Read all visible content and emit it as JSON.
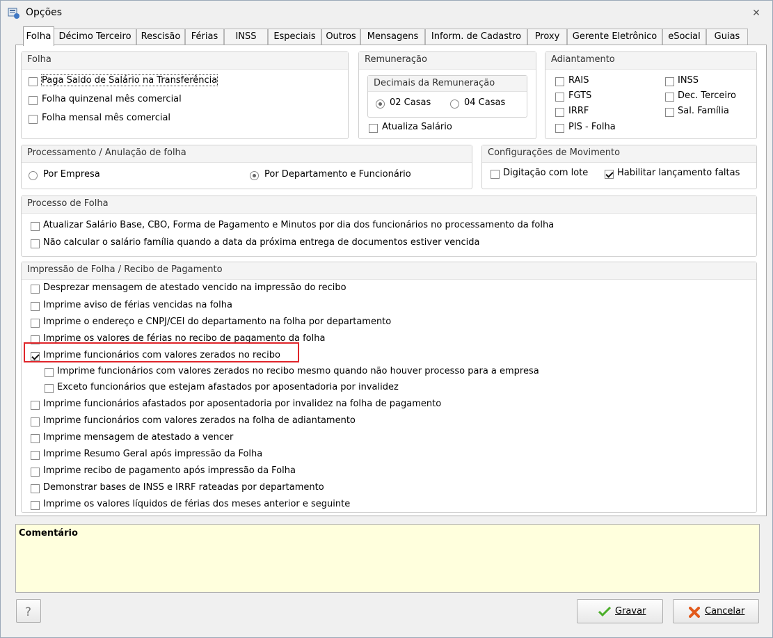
{
  "window": {
    "title": "Opções"
  },
  "tabs": [
    "Folha",
    "Décimo Terceiro",
    "Rescisão",
    "Férias",
    "INSS",
    "Especiais",
    "Outros",
    "Mensagens",
    "Inform. de Cadastro",
    "Proxy",
    "Gerente Eletrônico",
    "eSocial",
    "Guias"
  ],
  "folha_group": {
    "title": "Folha",
    "items": [
      {
        "label": "Paga Saldo de Salário na Transferência",
        "checked": false
      },
      {
        "label": "Folha quinzenal mês comercial",
        "checked": false
      },
      {
        "label": "Folha mensal mês comercial",
        "checked": false
      }
    ]
  },
  "remuneracao": {
    "title": "Remuneração",
    "decimais_title": "Decimais da Remuneração",
    "options": [
      {
        "label": "02 Casas",
        "selected": true
      },
      {
        "label": "04 Casas",
        "selected": false
      }
    ],
    "atualiza_label": "Atualiza Salário"
  },
  "adiantamento": {
    "title": "Adiantamento",
    "left": [
      "RAIS",
      "FGTS",
      "IRRF",
      "PIS - Folha"
    ],
    "right": [
      "INSS",
      "Dec. Terceiro",
      "Sal. Família"
    ]
  },
  "processamento": {
    "title": "Processamento / Anulação de folha",
    "options": [
      {
        "label": "Por Empresa",
        "selected": false
      },
      {
        "label": "Por Departamento e Funcionário",
        "selected": true
      }
    ]
  },
  "config_movimento": {
    "title": "Configurações de Movimento",
    "items": [
      {
        "label": "Digitação com lote",
        "checked": false
      },
      {
        "label": "Habilitar lançamento faltas",
        "checked": true
      }
    ]
  },
  "processo_folha": {
    "title": "Processo de Folha",
    "items": [
      "Atualizar Salário Base, CBO, Forma de Pagamento e Minutos por dia dos funcionários no processamento da folha",
      "Não calcular o salário família quando a data da próxima entrega de documentos estiver vencida"
    ]
  },
  "impressao": {
    "title": "Impressão de Folha / Recibo de Pagamento",
    "items": [
      {
        "label": "Desprezar mensagem de atestado vencido na impressão do recibo",
        "checked": false,
        "indent": 0
      },
      {
        "label": "Imprime aviso de férias vencidas na folha",
        "checked": false,
        "indent": 0
      },
      {
        "label": "Imprime o endereço e CNPJ/CEI do departamento na folha por departamento",
        "checked": false,
        "indent": 0
      },
      {
        "label": "Imprime os valores de férias no recibo de pagamento da folha",
        "checked": false,
        "indent": 0
      },
      {
        "label": "Imprime funcionários com valores zerados no recibo",
        "checked": true,
        "indent": 0
      },
      {
        "label": "Imprime funcionários com valores zerados no recibo mesmo quando não houver processo para a empresa",
        "checked": false,
        "indent": 1
      },
      {
        "label": "Exceto funcionários que estejam afastados por aposentadoria por invalidez",
        "checked": false,
        "indent": 1
      },
      {
        "label": "Imprime funcionários afastados por aposentadoria por invalidez na folha de pagamento",
        "checked": false,
        "indent": 0
      },
      {
        "label": "Imprime funcionários com valores zerados na folha de adiantamento",
        "checked": false,
        "indent": 0
      },
      {
        "label": "Imprime mensagem de  atestado a vencer",
        "checked": false,
        "indent": 0
      },
      {
        "label": "Imprime Resumo Geral após impressão da Folha",
        "checked": false,
        "indent": 0
      },
      {
        "label": "Imprime recibo de pagamento após impressão da Folha",
        "checked": false,
        "indent": 0
      },
      {
        "label": "Demonstrar bases de INSS e IRRF rateadas por departamento",
        "checked": false,
        "indent": 0
      },
      {
        "label": "Imprime os valores líquidos de férias dos meses anterior e seguinte",
        "checked": false,
        "indent": 0
      }
    ]
  },
  "comentario": {
    "title": "Comentário",
    "value": ""
  },
  "buttons": {
    "help": "?",
    "save": "Gravar",
    "cancel": "Cancelar"
  },
  "colors": {
    "highlight": "#e0252a",
    "comment_bg": "#ffffdd",
    "save_icon": "#4caf2a",
    "cancel_icon": "#e25a1c"
  }
}
